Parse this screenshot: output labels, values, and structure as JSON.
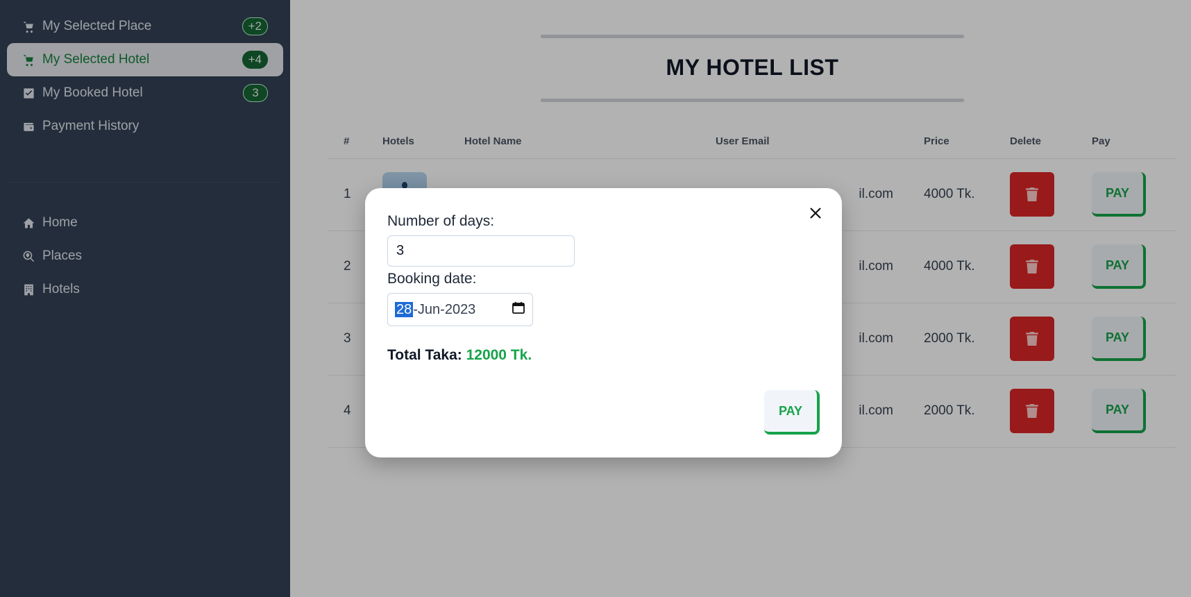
{
  "sidebar": {
    "items": [
      {
        "label": "My Selected Place",
        "badge": "+2",
        "icon": "cart-icon"
      },
      {
        "label": "My Selected Hotel",
        "badge": "+4",
        "icon": "cart-icon"
      },
      {
        "label": "My Booked Hotel",
        "badge": "3",
        "icon": "check-square-icon"
      },
      {
        "label": "Payment History",
        "icon": "wallet-icon"
      }
    ],
    "nav": [
      {
        "label": "Home",
        "icon": "home-icon"
      },
      {
        "label": "Places",
        "icon": "search-location-icon"
      },
      {
        "label": "Hotels",
        "icon": "building-icon"
      }
    ]
  },
  "main": {
    "title": "MY HOTEL LIST",
    "columns": [
      "#",
      "Hotels",
      "Hotel Name",
      "User Email",
      "Price",
      "Delete",
      "Pay"
    ],
    "rows": [
      {
        "num": "1",
        "email": "il.com",
        "price": "4000 Tk.",
        "pay": "PAY"
      },
      {
        "num": "2",
        "email": "il.com",
        "price": "4000 Tk.",
        "pay": "PAY"
      },
      {
        "num": "3",
        "email": "il.com",
        "price": "2000 Tk.",
        "pay": "PAY"
      },
      {
        "num": "4",
        "email": "il.com",
        "price": "2000 Tk.",
        "pay": "PAY"
      }
    ]
  },
  "modal": {
    "days_label": "Number of days:",
    "days_value": "3",
    "date_label": "Booking date:",
    "date_day": "28",
    "date_rest": "-Jun-2023",
    "total_label": "Total Taka:",
    "total_amount": "12000 Tk.",
    "pay_label": "PAY"
  },
  "colors": {
    "sidebar_bg": "#334155",
    "accent_green": "#16a34a",
    "delete_red": "#dc2626"
  }
}
